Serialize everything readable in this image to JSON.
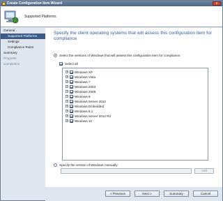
{
  "window": {
    "title": "Create Configuration Item Wizard",
    "close_glyph": "x"
  },
  "header": {
    "title": "Supported Platforms"
  },
  "nav": {
    "items": [
      {
        "label": "General"
      },
      {
        "label": "Supported Platforms"
      },
      {
        "label": "Settings"
      },
      {
        "label": "Compliance Rules"
      },
      {
        "label": "Summary"
      },
      {
        "label": "Progress"
      },
      {
        "label": "Completion"
      }
    ]
  },
  "content": {
    "instruction": "Specify the client operating systems that will assess this configuration item for compliance",
    "option_select_label": "Select the versions of Windows that will assess this configuration item for compliance:",
    "select_all_label": "Select all",
    "os_list": [
      "Windows XP",
      "Windows Vista",
      "Windows 7",
      "Windows 2003",
      "Windows 2008",
      "Windows 8",
      "Windows Server 2012",
      "Windows Embedded",
      "Windows 8.1",
      "Windows Server 2012 R2",
      "Windows 10"
    ],
    "option_manual_label": "Specify the version of Windows manually:",
    "manual_value": "",
    "add_label": "Add"
  },
  "footer": {
    "previous_label": "< Previous",
    "next_label": "Next >",
    "summary_label": "Summary",
    "cancel_label": "Cancel"
  }
}
